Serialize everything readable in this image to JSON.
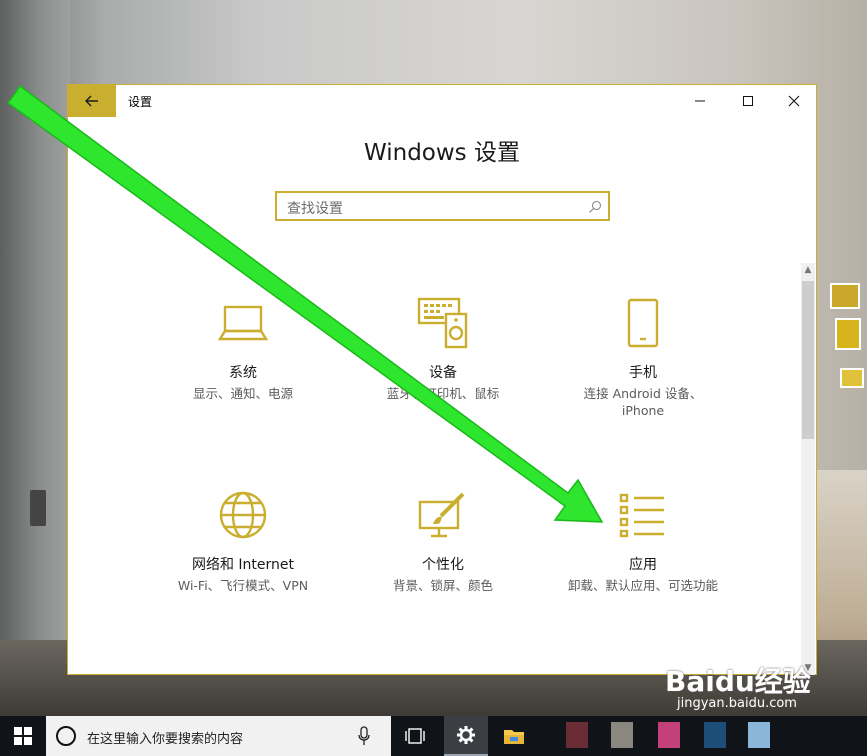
{
  "window": {
    "title": "设置",
    "heading": "Windows 设置",
    "search_placeholder": "查找设置"
  },
  "tiles": [
    {
      "title": "系统",
      "desc": "显示、通知、电源",
      "icon": "laptop-icon"
    },
    {
      "title": "设备",
      "desc": "蓝牙、打印机、鼠标",
      "icon": "keyboard-speaker-icon"
    },
    {
      "title": "手机",
      "desc": "连接 Android 设备、iPhone",
      "icon": "phone-icon"
    },
    {
      "title": "网络和 Internet",
      "desc": "Wi-Fi、飞行模式、VPN",
      "icon": "globe-icon"
    },
    {
      "title": "个性化",
      "desc": "背景、锁屏、颜色",
      "icon": "paintbrush-icon"
    },
    {
      "title": "应用",
      "desc": "卸载、默认应用、可选功能",
      "icon": "apps-list-icon"
    }
  ],
  "taskbar": {
    "search_text": "在这里输入你要搜索的内容"
  },
  "watermark": {
    "brand": "Baidu经验",
    "url": "jingyan.baidu.com"
  },
  "colors": {
    "accent": "#c9ae2f",
    "annotation_arrow": "#2ee62e",
    "taskbar": "#101418"
  }
}
